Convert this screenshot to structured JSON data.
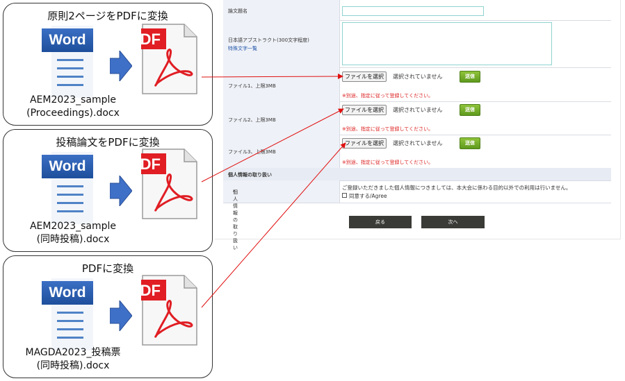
{
  "panels": [
    {
      "title": "原則2ページをPDFに変換",
      "file_line1": "AEM2023_sample",
      "file_line2": "(Proceedings).docx"
    },
    {
      "title": "投稿論文をPDFに変換",
      "file_line1": "AEM2023_sample",
      "file_line2": "(同時投稿).docx"
    },
    {
      "title": "PDFに変換",
      "file_line1": "MAGDA2023_投稿票",
      "file_line2": "(同時投稿).docx"
    }
  ],
  "icons": {
    "word_label": "Word",
    "pdf_label": "PDF"
  },
  "form": {
    "title_row_label": "論文題名",
    "abstract_label": "日本語アブストラクト(300文字程度)",
    "special_chars_link": "特殊文字一覧",
    "file_rows": [
      {
        "label": "ファイル1、上限3MB"
      },
      {
        "label": "ファイル2、上限3MB"
      },
      {
        "label": "ファイル3、上限3MB"
      }
    ],
    "choose_file_label": "ファイルを選択",
    "no_file_text": "選択されていません",
    "send_label": "送信",
    "file_note": "※別途、指定に従って登録してください。",
    "privacy_section": "個人情報の取り扱い",
    "privacy_label": "個人情報の取り扱い",
    "required_mark": "*",
    "privacy_text": "ご登録いただきました個人情報につきましては、本大会に係わる目的以外での利用は行いません。",
    "agree_label": "同意する/Agree",
    "back_label": "戻る",
    "next_label": "次へ"
  },
  "colors": {
    "arrow": "#e01010",
    "word_blue": "#2b5fb0",
    "pdf_red": "#e01e24",
    "send_green": "#6aa827"
  }
}
